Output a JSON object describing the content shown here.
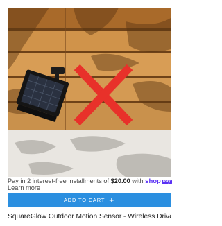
{
  "product": {
    "image_alt": "Solar motion sensor light mounted on wooden wall, crossed out",
    "installments_prefix": "Pay in 2 interest-free installments of ",
    "installments_amount": "$20.00",
    "installments_with": " with ",
    "shop_pay_label": "shop",
    "shop_pay_box": "Pay",
    "learn_more": "Learn more",
    "add_to_cart_label": "ADD TO CART",
    "add_to_cart_icon": "plus-icon",
    "title": "SquareGlow Outdoor Motion Sensor - Wireless Driveway"
  },
  "colors": {
    "accent": "#2b8fe0",
    "cross": "#e8312a",
    "shop_pay": "#5a31f4"
  }
}
